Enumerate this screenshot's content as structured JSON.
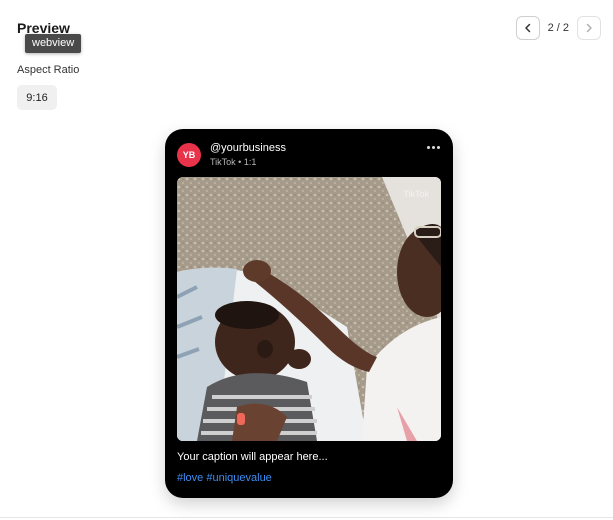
{
  "header": {
    "title": "Preview",
    "tooltip": "webview"
  },
  "pager": {
    "prev_icon": "chevron-left-icon",
    "next_icon": "chevron-right-icon",
    "text": "2 / 2"
  },
  "aspect": {
    "label": "Aspect Ratio",
    "value": "9:16"
  },
  "post": {
    "avatar_initials": "YB",
    "avatar_color": "#e8334a",
    "handle": "@yourbusiness",
    "subline": "TikTok • 1:1",
    "more_icon": "more-horizontal-icon",
    "watermark": "TikTok",
    "caption": "Your caption will appear here...",
    "hashtags": "#love #uniquevalue",
    "hashtag_color": "#3d8ef2"
  }
}
